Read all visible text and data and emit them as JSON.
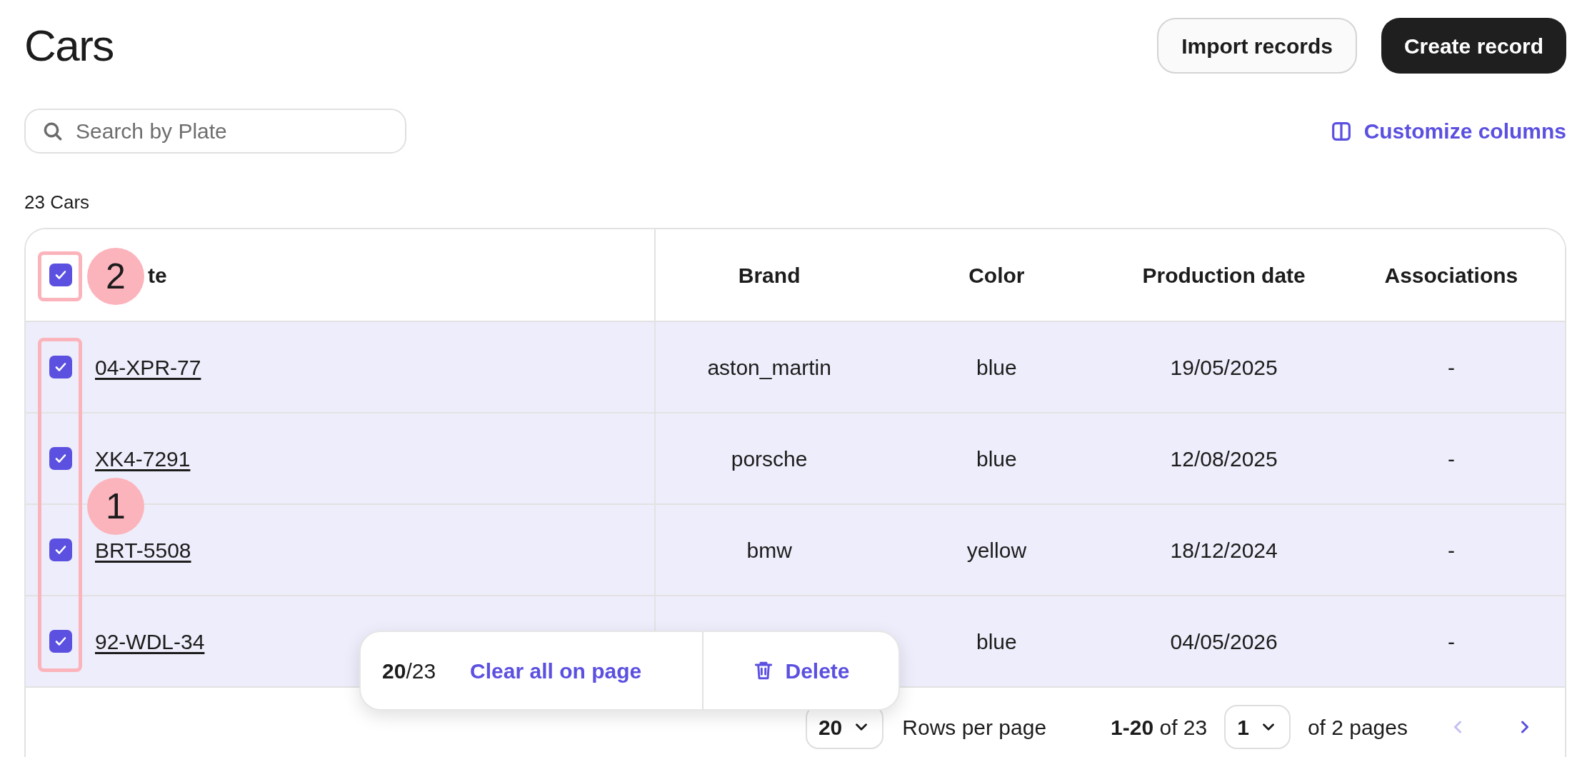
{
  "page": {
    "title": "Cars"
  },
  "actions": [
    {
      "label": "Import records",
      "kind": "secondary"
    },
    {
      "label": "Create record",
      "kind": "primary"
    }
  ],
  "search": {
    "placeholder": "Search by Plate"
  },
  "customize_columns": "Customize columns",
  "count": "23 Cars",
  "table": {
    "select_all": {
      "checked": true
    },
    "columns": [
      "te",
      "Brand",
      "Color",
      "Production date",
      "Associations"
    ],
    "rows": [
      {
        "checked": true,
        "plate": "04-XPR-77",
        "brand": "aston_martin",
        "car_color": "blue",
        "date": "19/05/2025",
        "associations": "-"
      },
      {
        "checked": true,
        "plate": "XK4-7291",
        "brand": "porsche",
        "car_color": "blue",
        "date": "12/08/2025",
        "associations": "-"
      },
      {
        "checked": true,
        "plate": "BRT-5508",
        "brand": "bmw",
        "car_color": "yellow",
        "date": "18/12/2024",
        "associations": "-"
      },
      {
        "checked": true,
        "plate": "92-WDL-34",
        "car_color": "blue",
        "date": "04/05/2026",
        "associations": "-"
      }
    ]
  },
  "annotations": [
    {
      "label": "2",
      "kind": "header"
    },
    {
      "label": "1",
      "kind": "rows"
    }
  ],
  "bulk_bar": {
    "selected": "20",
    "total": "/23",
    "clear": "Clear all on page",
    "delete": "Delete"
  },
  "pagination": {
    "rows_per_page_value": "20",
    "rows_per_page_label": "Rows per page",
    "range": "1-20",
    "of_total": "of 23",
    "page_value": "1",
    "of_pages": "of 2 pages",
    "prev_disabled": true,
    "next_disabled": false
  }
}
